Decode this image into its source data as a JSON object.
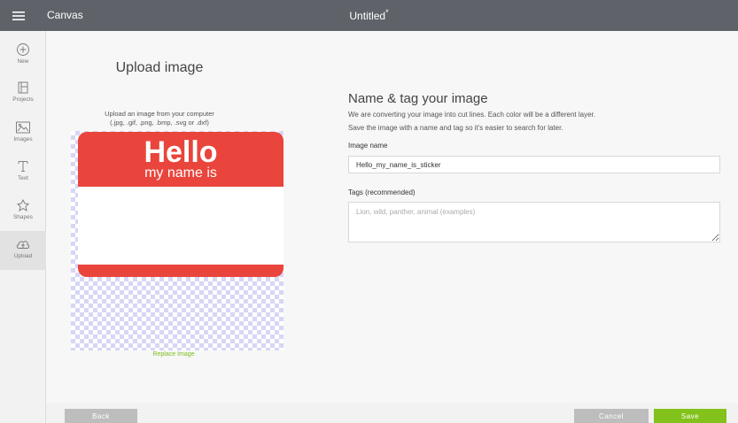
{
  "topbar": {
    "app_title": "Canvas",
    "document_title": "Untitled",
    "unsaved_marker": "*"
  },
  "sidebar": {
    "items": [
      {
        "label": "New",
        "icon": "plus-circle-icon"
      },
      {
        "label": "Projects",
        "icon": "projects-icon"
      },
      {
        "label": "Images",
        "icon": "images-icon"
      },
      {
        "label": "Text",
        "icon": "text-icon"
      },
      {
        "label": "Shapes",
        "icon": "shapes-icon"
      },
      {
        "label": "Upload",
        "icon": "upload-cloud-icon",
        "active": true
      }
    ]
  },
  "upload_panel": {
    "heading": "Upload image",
    "subtitle_line1": "Upload an image from your computer",
    "subtitle_line2": "(.jpg, .gif, .png, .bmp, .svg or .dxf)",
    "preview_text_line1": "Hello",
    "preview_text_line2": "my name is",
    "replace_link": "Replace Image"
  },
  "tag_panel": {
    "heading": "Name & tag your image",
    "description_line1": "We are converting your image into cut lines. Each color will be a different layer.",
    "description_line2": "Save the image with a name and tag so it's easier to search for later.",
    "image_name_label": "Image name",
    "image_name_value": "Hello_my_name_is_sticker",
    "tags_label": "Tags (recommended)",
    "tags_placeholder": "Lion, wild, panther, animal (examples)"
  },
  "footer": {
    "back_label": "Back",
    "cancel_label": "Cancel",
    "save_label": "Save"
  },
  "colors": {
    "topbar": "#5f6369",
    "accent_green": "#82c21b",
    "sticker_red": "#e9453c",
    "checker": "#d6d6f5"
  }
}
